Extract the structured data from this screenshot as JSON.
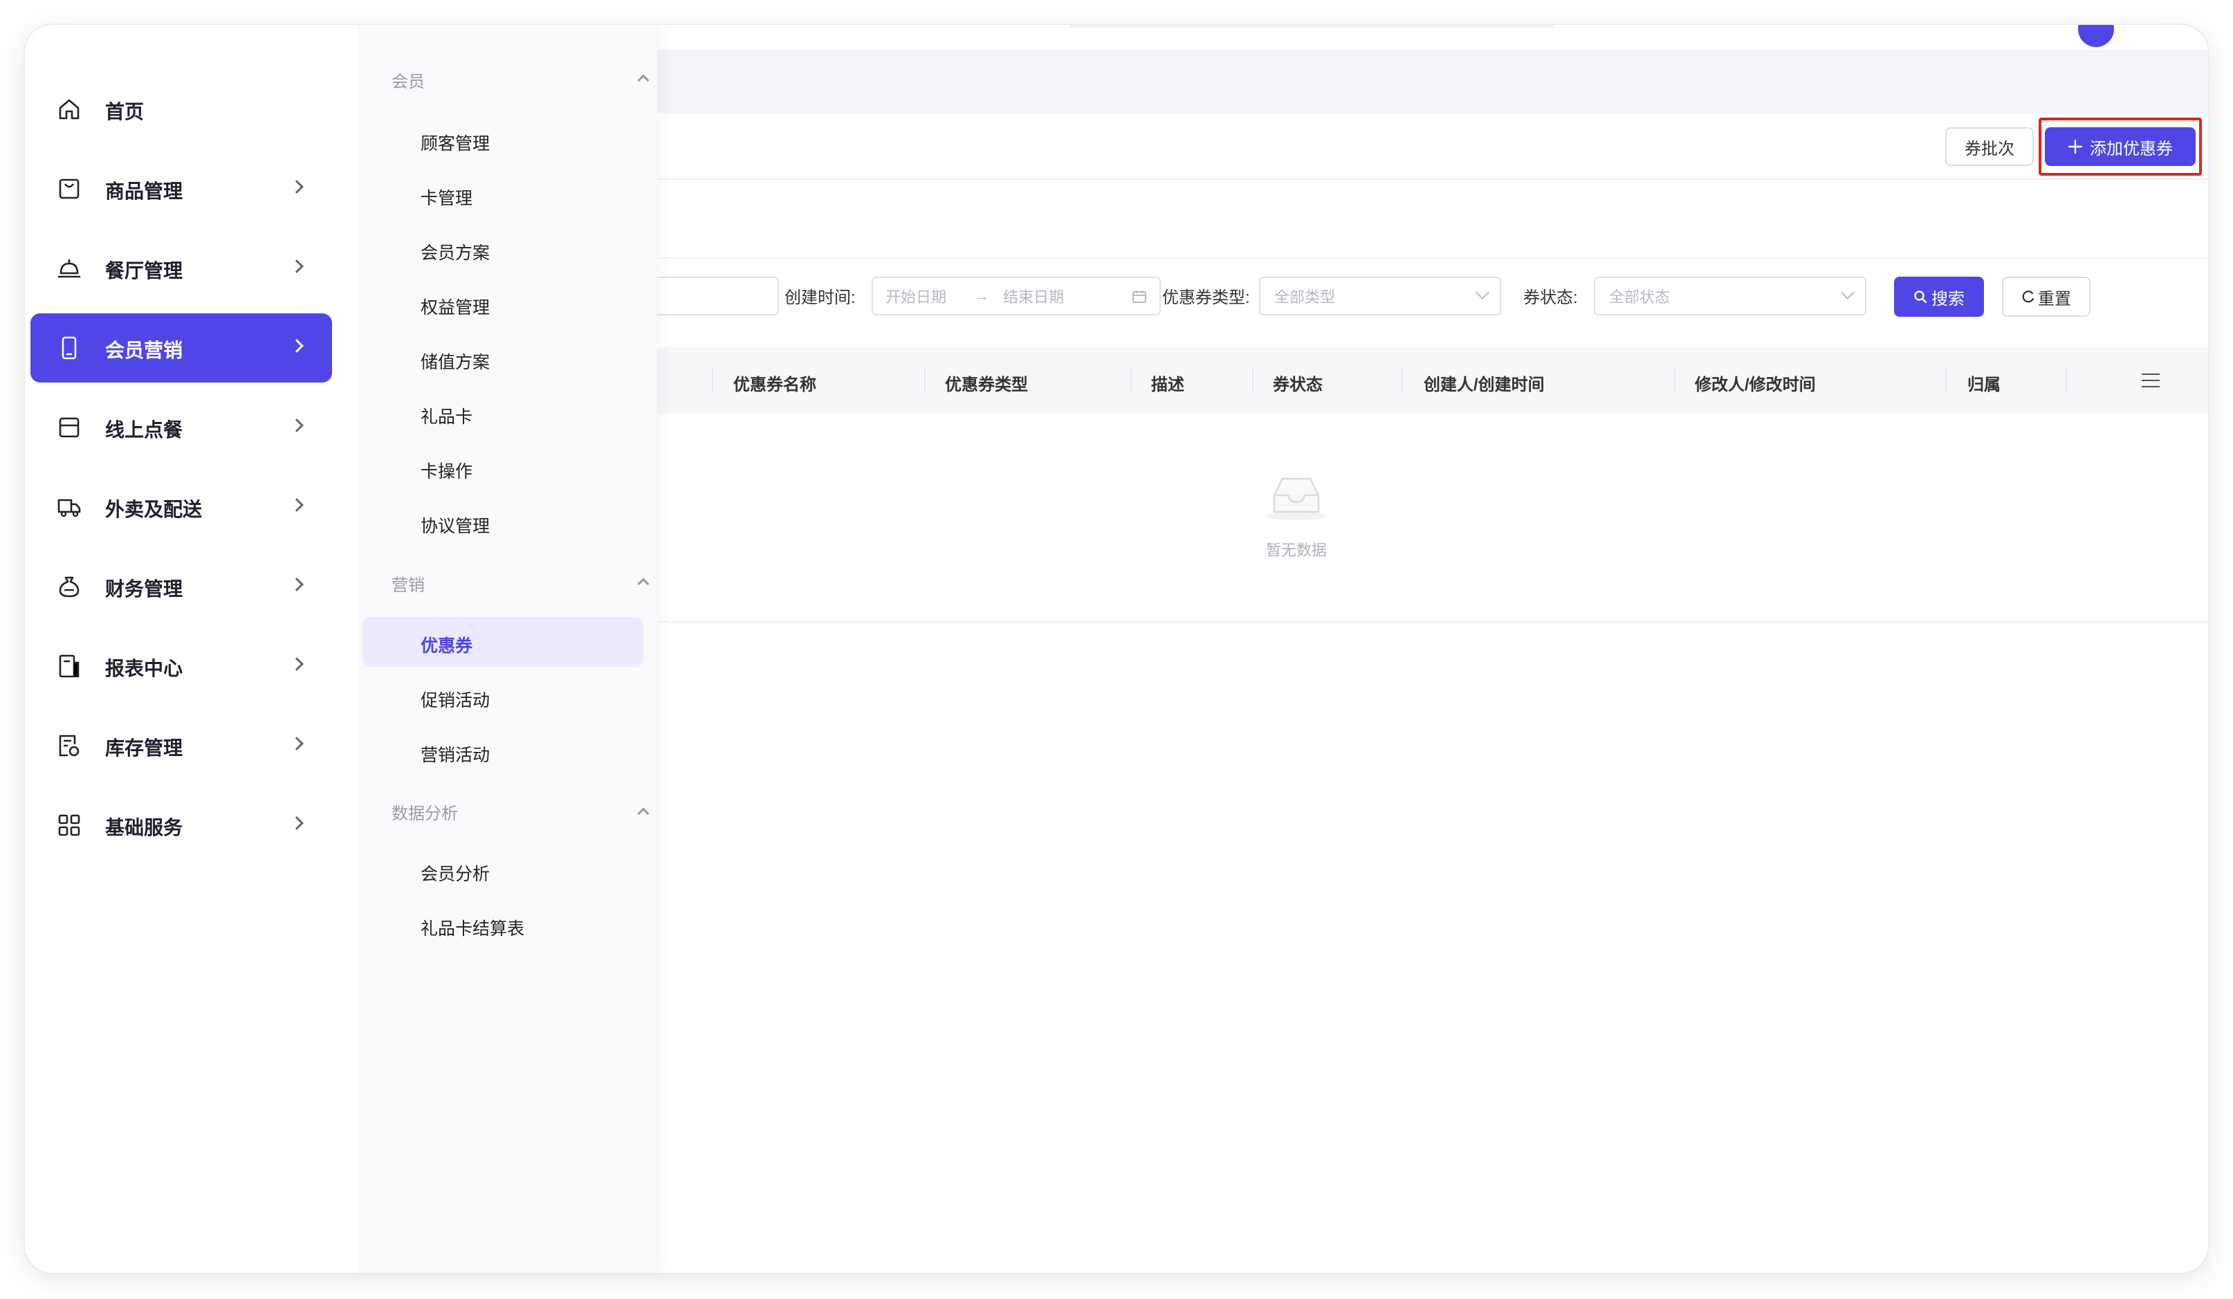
{
  "sidebar": {
    "items": [
      {
        "label": "首页",
        "icon": "home-icon",
        "has_children": false
      },
      {
        "label": "商品管理",
        "icon": "bag-icon",
        "has_children": true
      },
      {
        "label": "餐厅管理",
        "icon": "cloche-icon",
        "has_children": true
      },
      {
        "label": "会员营销",
        "icon": "phone-icon",
        "has_children": true,
        "active": true
      },
      {
        "label": "线上点餐",
        "icon": "store-icon",
        "has_children": true
      },
      {
        "label": "外卖及配送",
        "icon": "truck-icon",
        "has_children": true
      },
      {
        "label": "财务管理",
        "icon": "moneybag-icon",
        "has_children": true
      },
      {
        "label": "报表中心",
        "icon": "report-icon",
        "has_children": true
      },
      {
        "label": "库存管理",
        "icon": "inventory-icon",
        "has_children": true
      },
      {
        "label": "基础服务",
        "icon": "grid-icon",
        "has_children": true
      }
    ]
  },
  "submenu": {
    "groups": [
      {
        "title": "会员",
        "items": [
          "顾客管理",
          "卡管理",
          "会员方案",
          "权益管理",
          "储值方案",
          "礼品卡",
          "卡操作",
          "协议管理"
        ]
      },
      {
        "title": "营销",
        "items": [
          "优惠券",
          "促销活动",
          "营销活动"
        ]
      },
      {
        "title": "数据分析",
        "items": [
          "会员分析",
          "礼品卡结算表"
        ]
      }
    ],
    "active_item": "优惠券"
  },
  "toolbar": {
    "batch_label": "券批次",
    "add_label": "添加优惠券"
  },
  "filters": {
    "created_time_label": "创建时间:",
    "start_placeholder": "开始日期",
    "arrow": "→",
    "end_placeholder": "结束日期",
    "type_label": "优惠券类型:",
    "type_value": "全部类型",
    "status_label": "券状态:",
    "status_value": "全部状态",
    "search_label": "搜索",
    "reset_label": "重置"
  },
  "table": {
    "columns": [
      "优惠券名称",
      "优惠券类型",
      "描述",
      "券状态",
      "创建人/创建时间",
      "修改人/修改时间",
      "归属"
    ],
    "empty_text": "暂无数据"
  },
  "colors": {
    "primary": "#4f46e5",
    "highlight": "#e1251b"
  }
}
